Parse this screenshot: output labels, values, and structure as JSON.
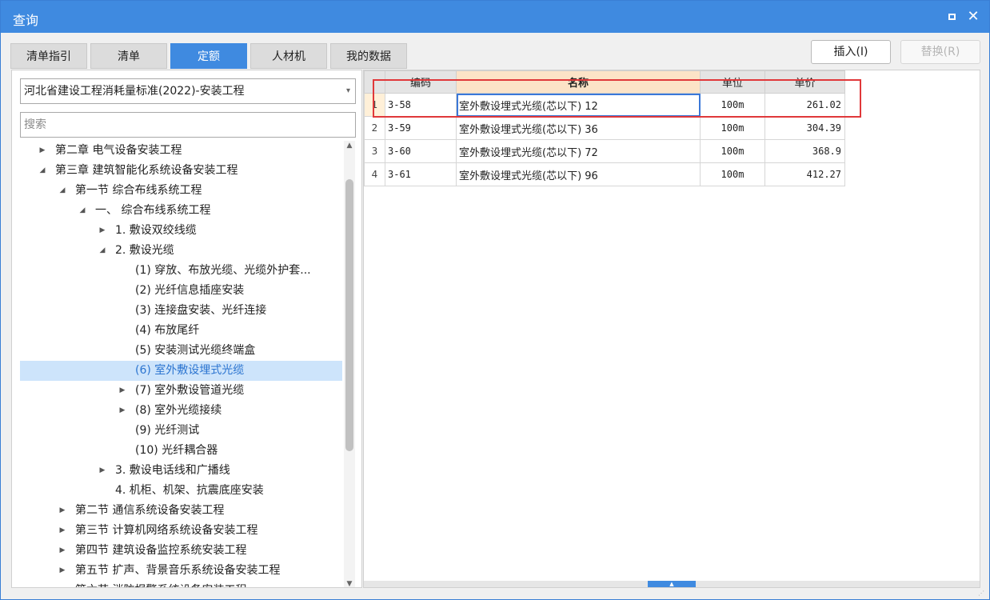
{
  "window": {
    "title": "查询",
    "maximize_label": "",
    "close_label": "✕"
  },
  "tabs": [
    {
      "label": "清单指引",
      "active": false
    },
    {
      "label": "清单",
      "active": false
    },
    {
      "label": "定额",
      "active": true
    },
    {
      "label": "人材机",
      "active": false
    },
    {
      "label": "我的数据",
      "active": false
    }
  ],
  "buttons": {
    "insert": "插入(I)",
    "replace": "替换(R)"
  },
  "library": {
    "selected": "河北省建设工程消耗量标准(2022)-安装工程",
    "arrow": "▾"
  },
  "search": {
    "placeholder": "搜索",
    "value": ""
  },
  "tree": [
    {
      "label": "第二章 电气设备安装工程",
      "toggle": "▶",
      "level": 1
    },
    {
      "label": "第三章 建筑智能化系统设备安装工程",
      "toggle": "◢",
      "level": 1
    },
    {
      "label": "第一节 综合布线系统工程",
      "toggle": "◢",
      "level": 2
    },
    {
      "label": "一、 综合布线系统工程",
      "toggle": "◢",
      "level": 3
    },
    {
      "label": "1. 敷设双绞线缆",
      "toggle": "▶",
      "level": 4
    },
    {
      "label": "2. 敷设光缆",
      "toggle": "◢",
      "level": 4
    },
    {
      "label": "(1) 穿放、布放光缆、光缆外护套...",
      "toggle": "",
      "level": 5
    },
    {
      "label": "(2) 光纤信息插座安装",
      "toggle": "",
      "level": 5
    },
    {
      "label": "(3) 连接盘安装、光纤连接",
      "toggle": "",
      "level": 5
    },
    {
      "label": "(4) 布放尾纤",
      "toggle": "",
      "level": 5
    },
    {
      "label": "(5) 安装测试光缆终端盒",
      "toggle": "",
      "level": 5
    },
    {
      "label": "(6) 室外敷设埋式光缆",
      "toggle": "",
      "level": 5,
      "selected": true
    },
    {
      "label": "(7) 室外敷设管道光缆",
      "toggle": "▶",
      "level": 5
    },
    {
      "label": "(8) 室外光缆接续",
      "toggle": "▶",
      "level": 5
    },
    {
      "label": "(9) 光纤测试",
      "toggle": "",
      "level": 5
    },
    {
      "label": "(10) 光纤耦合器",
      "toggle": "",
      "level": 5
    },
    {
      "label": "3. 敷设电话线和广播线",
      "toggle": "▶",
      "level": 4
    },
    {
      "label": "4. 机柜、机架、抗震底座安装",
      "toggle": "",
      "level": 4
    },
    {
      "label": "第二节 通信系统设备安装工程",
      "toggle": "▶",
      "level": 2
    },
    {
      "label": "第三节 计算机网络系统设备安装工程",
      "toggle": "▶",
      "level": 2
    },
    {
      "label": "第四节 建筑设备监控系统安装工程",
      "toggle": "▶",
      "level": 2
    },
    {
      "label": "第五节 扩声、背景音乐系统设备安装工程",
      "toggle": "▶",
      "level": 2
    },
    {
      "label": "第六节 消防报警系统设备安装工程",
      "toggle": "▶",
      "level": 2
    }
  ],
  "scroll": {
    "up": "▲",
    "down": "▼",
    "grip": "▲"
  },
  "grid": {
    "columns": [
      "",
      "编码",
      "名称",
      "单位",
      "单价"
    ],
    "rows": [
      {
        "idx": "1",
        "code": "3-58",
        "name": "室外敷设埋式光缆(芯以下) 12",
        "unit": "100m",
        "price": "261.02"
      },
      {
        "idx": "2",
        "code": "3-59",
        "name": "室外敷设埋式光缆(芯以下) 36",
        "unit": "100m",
        "price": "304.39"
      },
      {
        "idx": "3",
        "code": "3-60",
        "name": "室外敷设埋式光缆(芯以下) 72",
        "unit": "100m",
        "price": "368.9"
      },
      {
        "idx": "4",
        "code": "3-61",
        "name": "室外敷设埋式光缆(芯以下) 96",
        "unit": "100m",
        "price": "412.27"
      }
    ]
  },
  "colors": {
    "accent": "#3f8ae0",
    "highlight_box": "#e0383a",
    "tree_selected_bg": "#cde4fb"
  }
}
